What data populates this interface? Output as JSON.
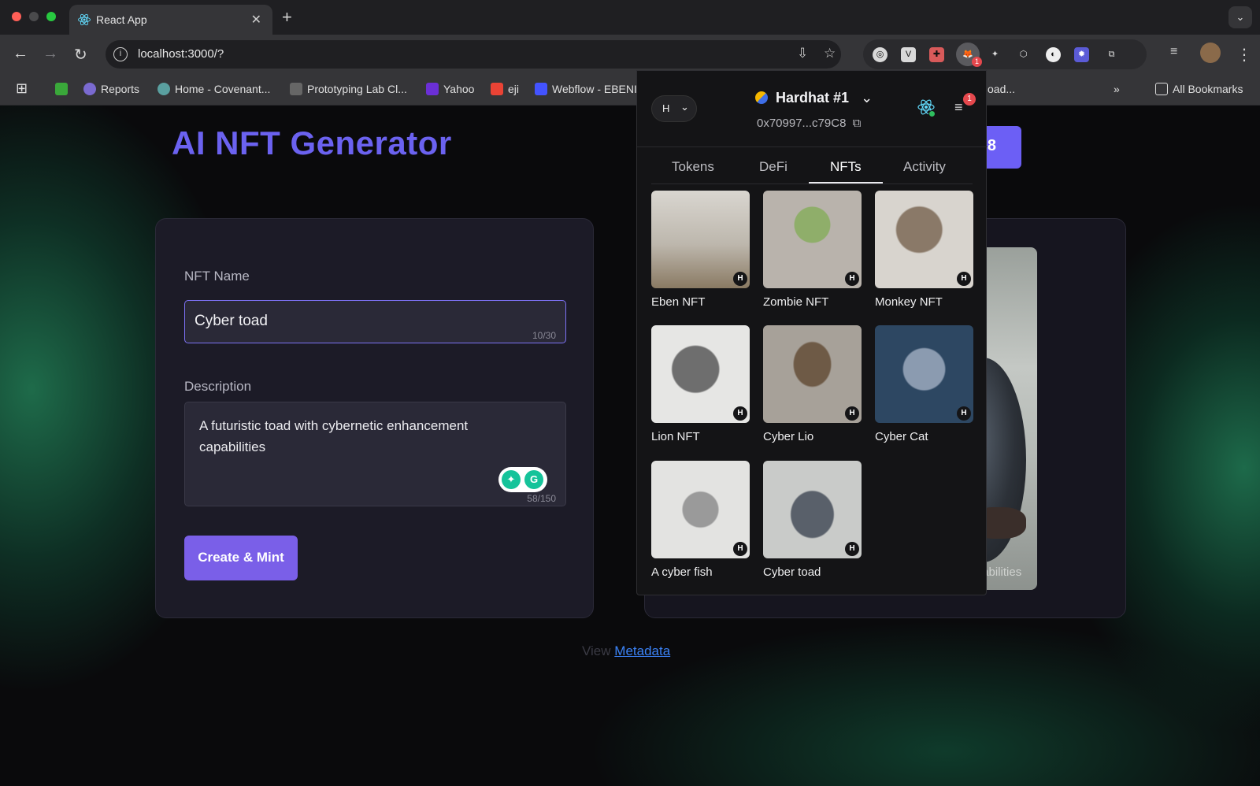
{
  "browser": {
    "tab_title": "React App",
    "url": "localhost:3000/?",
    "bookmarks": [
      "Reports",
      "Home - Covenant...",
      "Prototyping Lab Cl...",
      "Yahoo",
      "eji",
      "Webflow - EBENI",
      "oad...",
      "All Bookmarks"
    ],
    "extension_badge": "1"
  },
  "page": {
    "title": "AI NFT Generator",
    "connect_button_partial": "8",
    "form": {
      "name_label": "NFT Name",
      "name_value": "Cyber toad",
      "name_counter": "10/30",
      "description_label": "Description",
      "description_value": "A futuristic toad with cybernetic enhancement capabilities",
      "description_counter": "58/150",
      "submit_label": "Create & Mint"
    },
    "preview": {
      "caption_partial": "capabilities"
    },
    "metadata": {
      "prefix": "View",
      "link": "Metadata"
    }
  },
  "wallet": {
    "account_pill": "H",
    "account_name": "Hardhat #1",
    "address": "0x70997...c79C8",
    "notification_count": "1",
    "tabs": [
      "Tokens",
      "DeFi",
      "NFTs",
      "Activity"
    ],
    "active_tab": "NFTs",
    "nfts": [
      {
        "name": "Eben NFT",
        "badge": "H"
      },
      {
        "name": "Zombie NFT",
        "badge": "H"
      },
      {
        "name": "Monkey NFT",
        "badge": "H"
      },
      {
        "name": "Lion NFT",
        "badge": "H"
      },
      {
        "name": "Cyber Lio",
        "badge": "H"
      },
      {
        "name": "Cyber Cat",
        "badge": "H"
      },
      {
        "name": "A cyber fish",
        "badge": "H"
      },
      {
        "name": "Cyber toad",
        "badge": "H"
      }
    ]
  },
  "colors": {
    "accent": "#6b62f0",
    "button": "#7a5fe8",
    "link": "#3b82f6"
  }
}
